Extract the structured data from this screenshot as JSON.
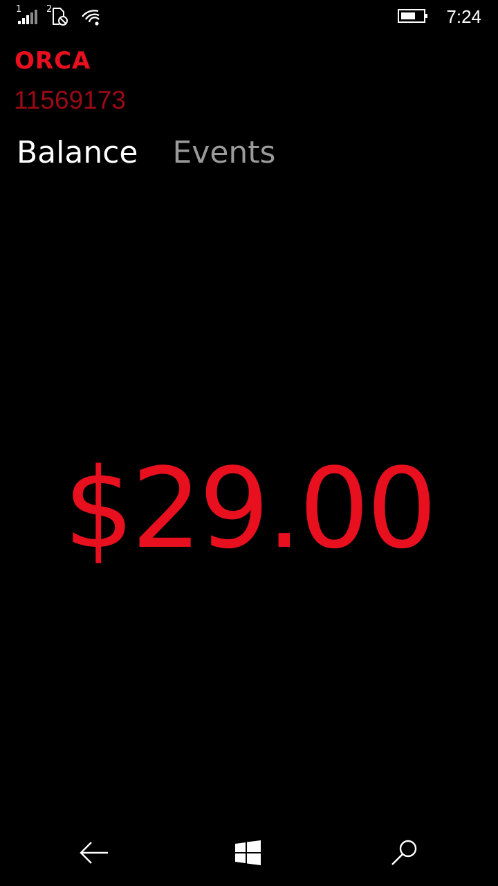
{
  "status_bar": {
    "sim1_label": "1",
    "sim2_label": "2",
    "time": "7:24",
    "icons": [
      "signal-strength-icon",
      "no-sim-icon",
      "wifi-icon",
      "battery-icon"
    ]
  },
  "header": {
    "app_title": "ORCA",
    "card_number": "11569173"
  },
  "tabs": [
    {
      "label": "Balance",
      "selected": true
    },
    {
      "label": "Events",
      "selected": false
    }
  ],
  "balance": {
    "amount": "$29.00"
  },
  "nav_bar": {
    "buttons": [
      "back-icon",
      "windows-start-icon",
      "search-icon"
    ]
  },
  "colors": {
    "accent": "#e8101e",
    "accent_dim": "#9c0a16",
    "background": "#000000",
    "text_primary": "#ffffff",
    "text_inactive": "#9a9a9a"
  }
}
